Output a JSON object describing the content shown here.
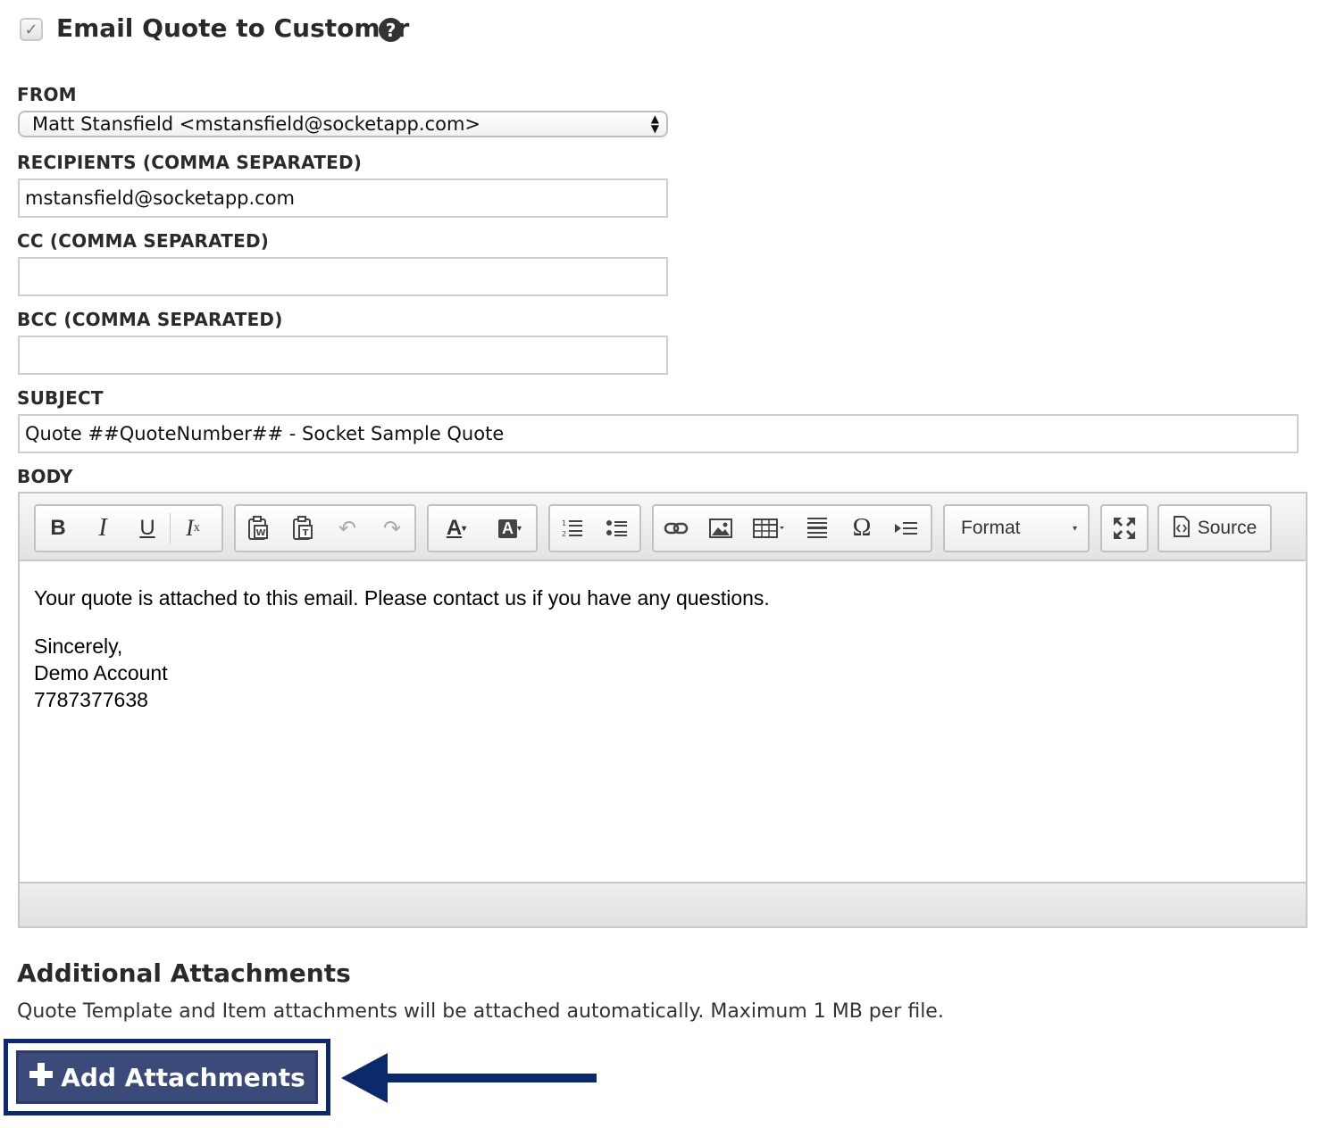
{
  "header": {
    "title": "Email Quote to Customer",
    "checked": true
  },
  "form": {
    "from": {
      "label": "FROM",
      "value": "Matt Stansfield <mstansfield@socketapp.com>"
    },
    "recipients": {
      "label": "RECIPIENTS (COMMA SEPARATED)",
      "value": "mstansfield@socketapp.com"
    },
    "cc": {
      "label": "CC (COMMA SEPARATED)",
      "value": ""
    },
    "bcc": {
      "label": "BCC (COMMA SEPARATED)",
      "value": ""
    },
    "subject": {
      "label": "SUBJECT",
      "value": "Quote ##QuoteNumber## - Socket Sample Quote"
    },
    "body_label": "BODY"
  },
  "editor": {
    "format_label": "Format",
    "source_label": "Source",
    "body_lines": [
      "Your quote is attached to this email. Please contact us if you have any questions.",
      "Sincerely,",
      "Demo Account",
      "7787377638"
    ]
  },
  "attachments": {
    "title": "Additional Attachments",
    "description": "Quote Template and Item attachments will be attached automatically. Maximum 1 MB per file.",
    "button_label": "Add Attachments"
  },
  "colors": {
    "button": "#3c4a7a",
    "highlight": "#0c2a6b"
  }
}
